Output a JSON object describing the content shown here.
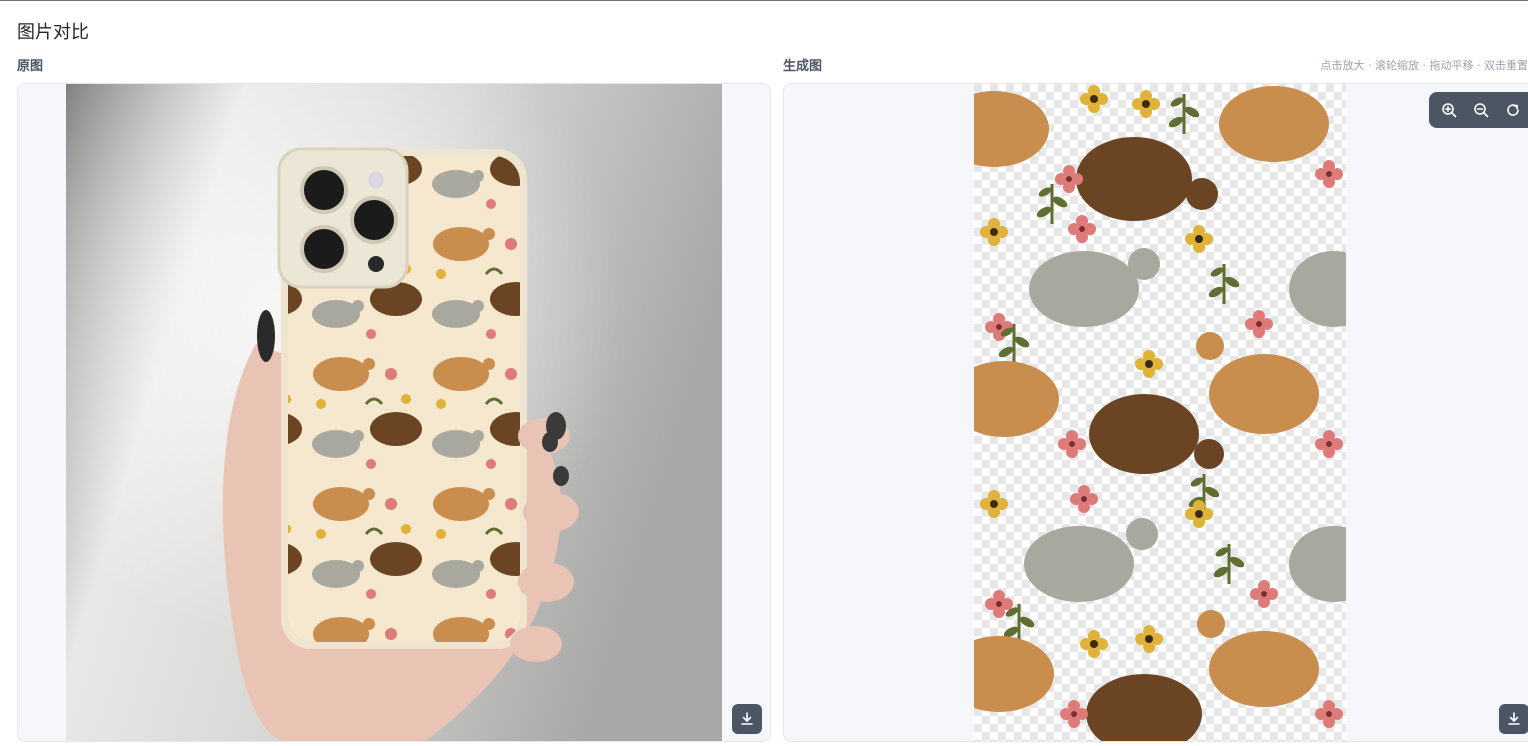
{
  "page": {
    "title": "图片对比"
  },
  "panels": {
    "original": {
      "label": "原图"
    },
    "generated": {
      "label": "生成图",
      "hint": "点击放大 · 滚轮缩放 · 拖动平移 · 双击重置"
    }
  },
  "toolbar": {
    "icons": [
      "zoom-in-icon",
      "zoom-out-icon",
      "reset-icon"
    ]
  },
  "colors": {
    "toolbar_bg": "#4b5563",
    "panel_bg": "#f5f7fb",
    "case_bg": "#f6e7cf",
    "hen_orange": "#c98d4e",
    "hen_brown": "#6b4523",
    "hen_gray": "#a9a89e",
    "flower_yellow": "#e0b237",
    "flower_pink": "#de7b79",
    "leaf_green": "#5f6e32"
  }
}
